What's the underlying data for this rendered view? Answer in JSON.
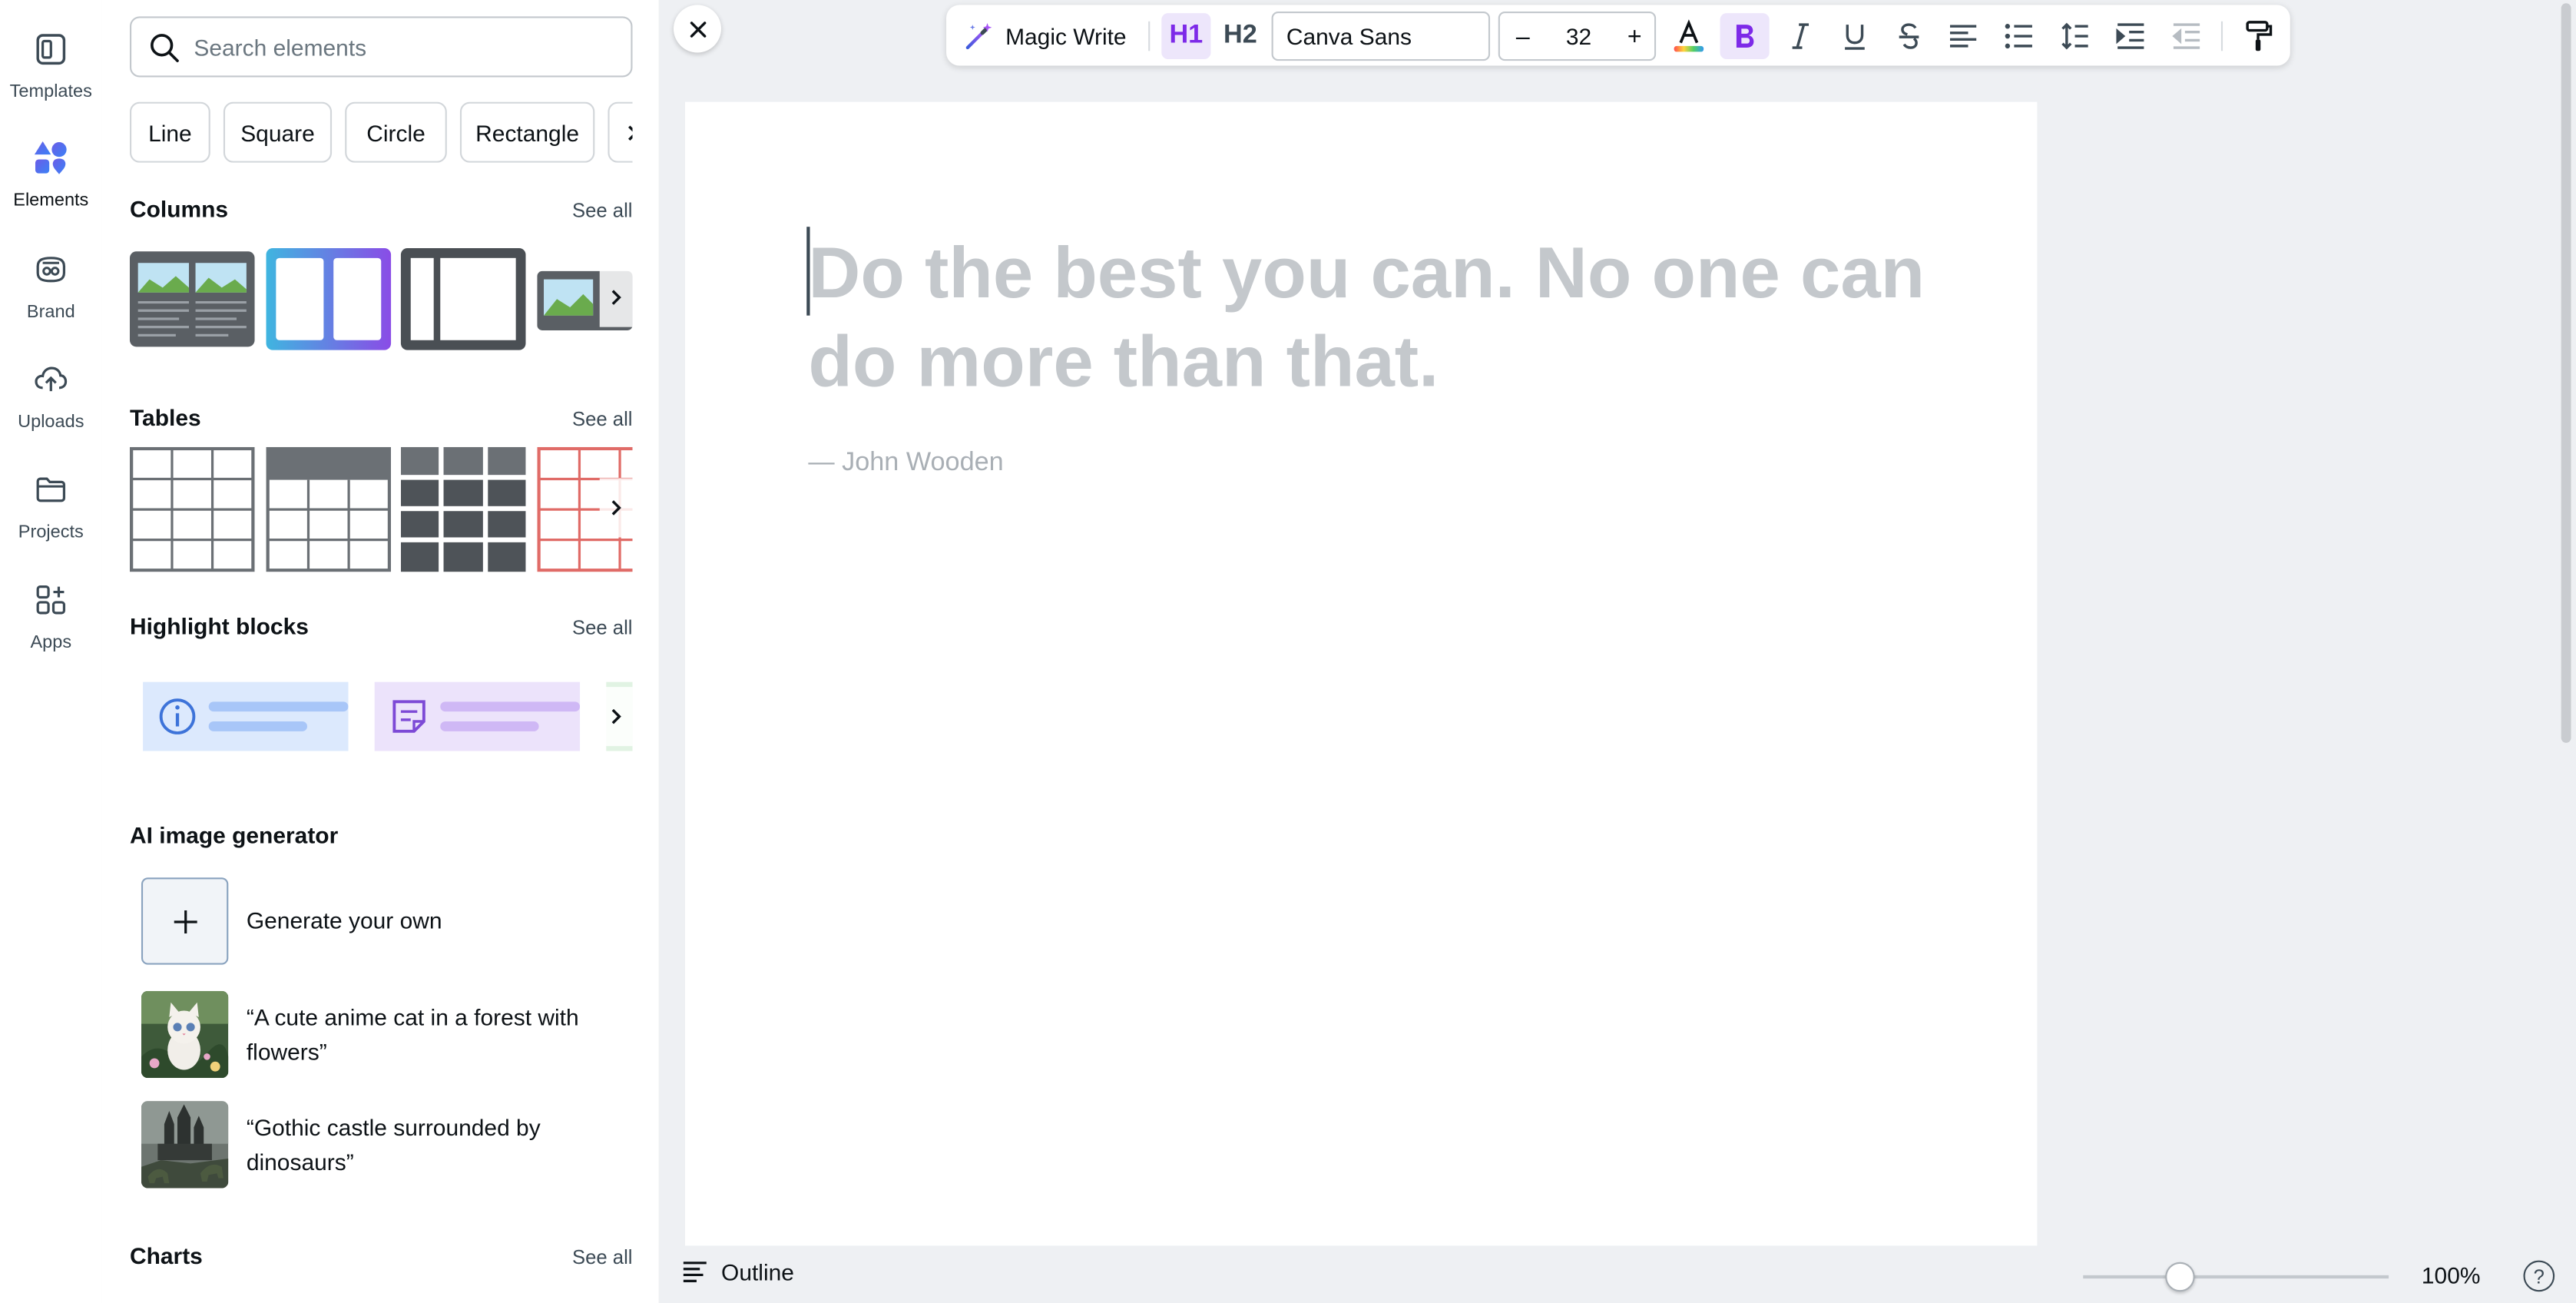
{
  "rail": {
    "items": [
      {
        "label": "Templates",
        "icon": "templates-icon"
      },
      {
        "label": "Elements",
        "icon": "elements-icon"
      },
      {
        "label": "Brand",
        "icon": "brand-icon"
      },
      {
        "label": "Uploads",
        "icon": "uploads-icon"
      },
      {
        "label": "Projects",
        "icon": "projects-icon"
      },
      {
        "label": "Apps",
        "icon": "apps-icon"
      }
    ],
    "active": "Elements"
  },
  "panel": {
    "search": {
      "placeholder": "Search elements",
      "value": ""
    },
    "chips": [
      "Line",
      "Square",
      "Circle",
      "Rectangle"
    ],
    "sections": {
      "columns": {
        "title": "Columns",
        "see_all": "See all"
      },
      "tables": {
        "title": "Tables",
        "see_all": "See all"
      },
      "highlight": {
        "title": "Highlight blocks",
        "see_all": "See all"
      },
      "ai": {
        "title": "AI image generator"
      },
      "charts": {
        "title": "Charts",
        "see_all": "See all"
      }
    },
    "ai_items": [
      {
        "label": "Generate your own"
      },
      {
        "label": "“A cute anime cat in a forest with flowers”"
      },
      {
        "label": "“Gothic castle surrounded by dinosaurs”"
      }
    ]
  },
  "toolbar": {
    "magic_write": "Magic Write",
    "h1": "H1",
    "h2": "H2",
    "font": "Canva Sans",
    "font_size": "32",
    "minus": "–",
    "plus": "+"
  },
  "document": {
    "heading_placeholder": "Do the best you can. No one can do more than that.",
    "quote_placeholder": "— John Wooden"
  },
  "bottom": {
    "outline": "Outline",
    "zoom": "100%",
    "help": "?"
  },
  "colors": {
    "accent": "#7d2ae8",
    "active_bg": "#ede6fb"
  }
}
